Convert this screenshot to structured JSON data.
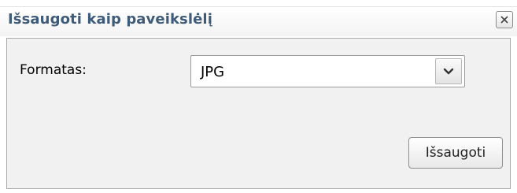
{
  "dialog": {
    "title": "Išsaugoti kaip paveikslėlį",
    "close_icon": "close-icon"
  },
  "form": {
    "format_label": "Formatas:",
    "format_value": "JPG",
    "dropdown_icon": "chevron-down-icon"
  },
  "actions": {
    "save_label": "Išsaugoti"
  },
  "colors": {
    "title_text": "#3f5b7a",
    "panel_bg": "#f1f1f1",
    "panel_border": "#a8a8a8"
  }
}
